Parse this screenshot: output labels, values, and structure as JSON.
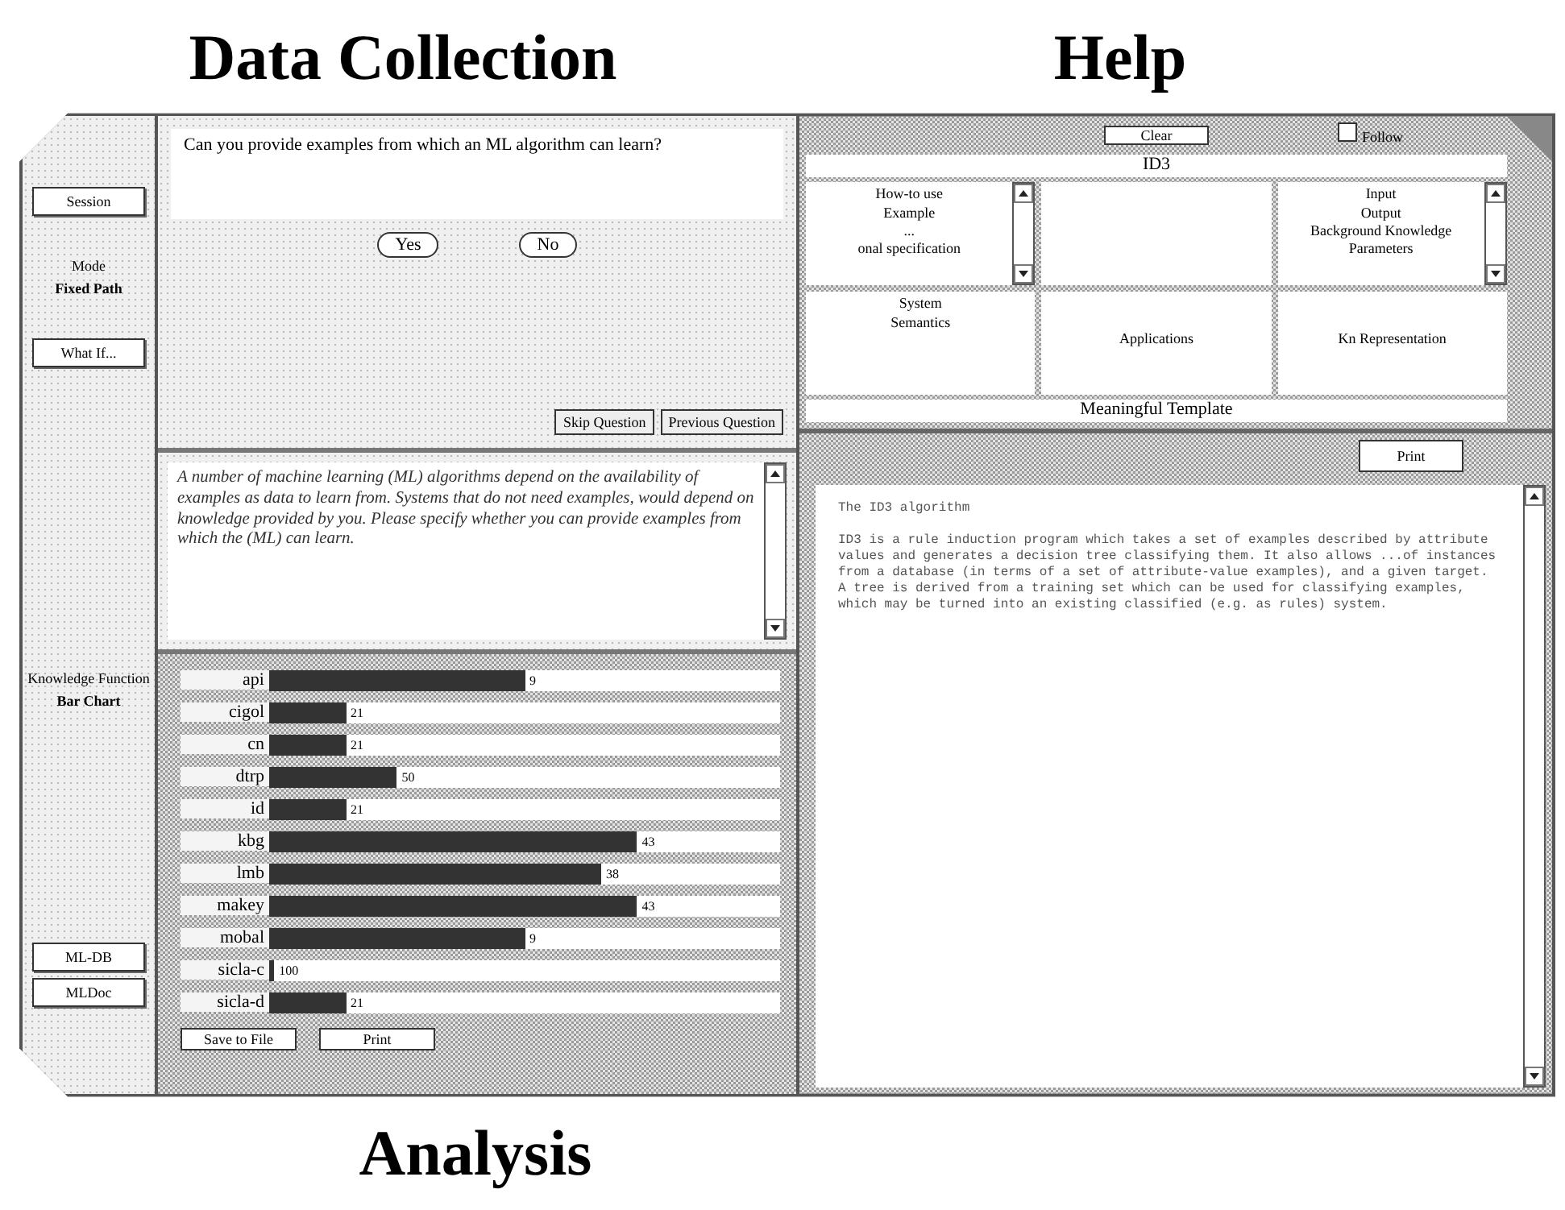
{
  "captions": {
    "top_left": "Data Collection",
    "top_right": "Help",
    "bottom": "Analysis"
  },
  "sidebar": {
    "session_button": "Session",
    "mode_label": "Mode",
    "mode_value": "Fixed Path",
    "whatif_button": "What If...",
    "chart_label": "Knowledge Function",
    "chart_value": "Bar Chart",
    "bottom_buttons": [
      "ML-DB",
      "MLDoc"
    ]
  },
  "question": {
    "text": "Can you provide examples from which an ML algorithm can learn?",
    "answers": [
      "Yes",
      "No"
    ],
    "nav_buttons": [
      "Skip Question",
      "Previous Question"
    ]
  },
  "explanation": "A number of machine learning (ML) algorithms depend on the availability of examples as data to learn from. Systems that do not need examples, would depend on knowledge provided by you. Please specify whether you can provide examples from which the (ML) can learn.",
  "bars": [
    {
      "label": "api",
      "level": 0.5,
      "reading": "9"
    },
    {
      "label": "cigol",
      "level": 0.15,
      "reading": "21"
    },
    {
      "label": "cn",
      "level": 0.15,
      "reading": "21"
    },
    {
      "label": "dtrp",
      "level": 0.25,
      "reading": "50"
    },
    {
      "label": "id",
      "level": 0.15,
      "reading": "21"
    },
    {
      "label": "kbg",
      "level": 0.72,
      "reading": "43"
    },
    {
      "label": "lmb",
      "level": 0.65,
      "reading": "38"
    },
    {
      "label": "makey",
      "level": 0.72,
      "reading": "43"
    },
    {
      "label": "mobal",
      "level": 0.5,
      "reading": "9"
    },
    {
      "label": "sicla-c",
      "level": 0.01,
      "reading": "100"
    },
    {
      "label": "sicla-d",
      "level": 0.15,
      "reading": "21"
    }
  ],
  "analysis_buttons": [
    "Save to File",
    "Print"
  ],
  "help": {
    "clear_button": "Clear",
    "checkbox": {
      "label": "Follow",
      "checked": false
    },
    "title": "ID3",
    "cells": [
      {
        "lines": [
          "How-to use",
          "Example",
          "...",
          "onal specification"
        ],
        "scroll": true
      },
      {
        "scroll": false
      },
      {
        "lines": [
          "Input",
          "Output",
          "Background Knowledge",
          "Parameters"
        ],
        "scroll": true
      },
      {
        "lines": [
          "System",
          "Semantics"
        ],
        "scroll": false
      },
      {
        "lines": [
          "Applications"
        ],
        "scroll": false
      },
      {
        "lines": [
          "Kn Representation"
        ],
        "scroll": false
      }
    ],
    "template": "Meaningful Template",
    "print_button": "Print",
    "doc_title": "The ID3 algorithm",
    "doc_body": "ID3 is a rule induction program which takes a set of examples described by attribute values and generates a decision tree classifying them. It also allows ...of instances from a database (in terms of a set of attribute-value examples), and a given target. A tree is derived from a training set which can be used for classifying examples, which may be turned into an existing classified (e.g. as rules) system."
  }
}
